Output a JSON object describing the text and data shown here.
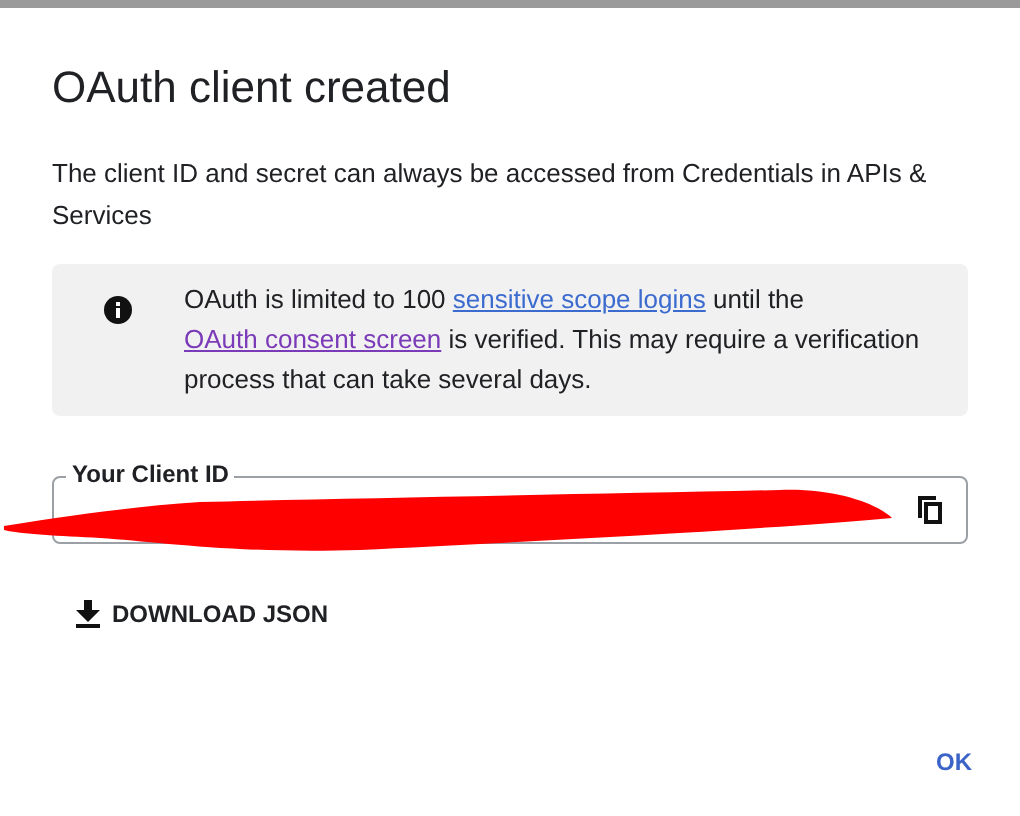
{
  "dialog": {
    "title": "OAuth client created",
    "description": "The client ID and secret can always be accessed from Credentials in APIs & Services",
    "notice": {
      "parts": [
        {
          "kind": "text",
          "text": "OAuth is limited to 100 "
        },
        {
          "kind": "link",
          "text": "sensitive scope logins",
          "visited": false
        },
        {
          "kind": "text",
          "text": " until the "
        },
        {
          "kind": "link",
          "text": "OAuth consent screen",
          "visited": true
        },
        {
          "kind": "text",
          "text": " is verified. This may require a verification process that can take several days."
        }
      ]
    },
    "client_id_field": {
      "label": "Your Client ID"
    },
    "download_button": "DOWNLOAD JSON",
    "ok_button": "OK"
  }
}
